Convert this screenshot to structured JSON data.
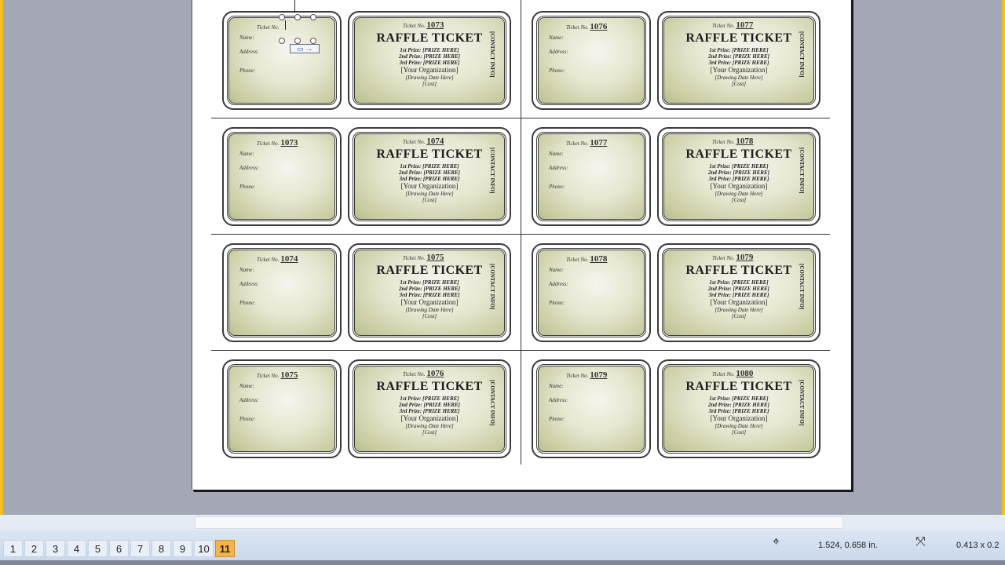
{
  "ticket_template": {
    "title": "RAFFLE TICKET",
    "ticket_no_label": "Ticket No.",
    "name_label": "Name:",
    "address_label": "Address:",
    "phone_label": "Phone:",
    "prize_1": "1st Prize: [PRIZE HERE]",
    "prize_2": "2nd Prize: [PRIZE HERE]",
    "prize_3": "3rd Prize: [PRIZE HERE]",
    "organization": "[Your Organization]",
    "drawing": "[Drawing Date Here]",
    "cost": "[Cost]",
    "vertical_text": "[CONTACT INFO]"
  },
  "stub_numbers": [
    "",
    "1076",
    "1073",
    "1077",
    "1074",
    "1078",
    "1075",
    "1079"
  ],
  "ticket_numbers": [
    "1073",
    "1077",
    "1074",
    "1078",
    "1075",
    "1079",
    "1076",
    "1080"
  ],
  "status_bar": {
    "pages": [
      "1",
      "2",
      "3",
      "4",
      "5",
      "6",
      "7",
      "8",
      "9",
      "10",
      "11"
    ],
    "active_page": "11",
    "position": "1.524, 0.658 in.",
    "size": "0.413 x 0.2"
  }
}
